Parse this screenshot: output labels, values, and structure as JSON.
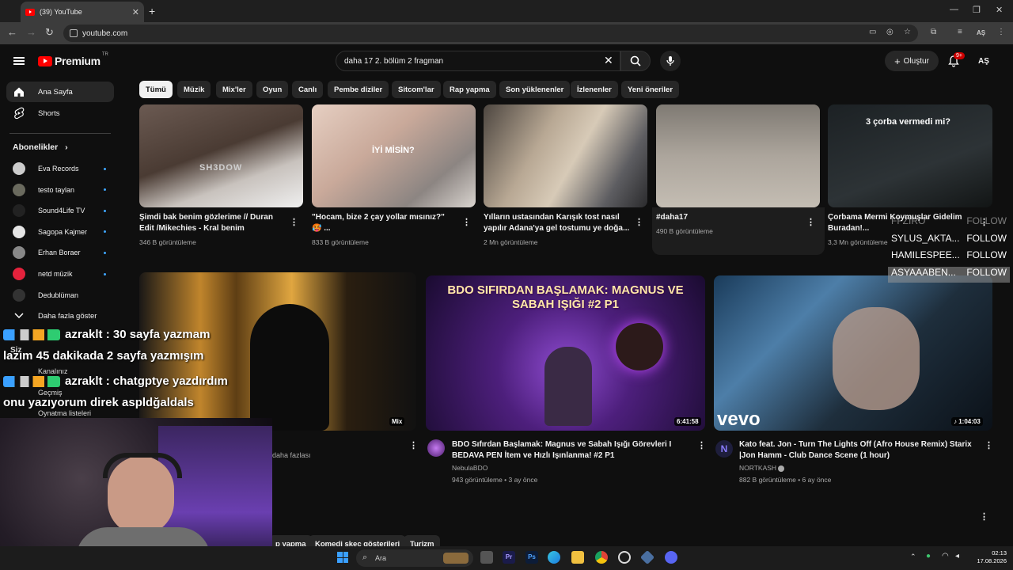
{
  "browser": {
    "tab_title": "(39) YouTube",
    "tab_close": "✕",
    "new_tab": "+",
    "url": "youtube.com",
    "profile_initials": "AŞ"
  },
  "header": {
    "logo_text": "Premium",
    "logo_region": "TR",
    "search_value": "daha 17 2. bölüm 2 fragman",
    "clear": "✕",
    "create_label": "Oluştur",
    "notif_count": "9+",
    "avatar_initials": "AŞ"
  },
  "chips": [
    "Tümü",
    "Müzik",
    "Mix'ler",
    "Oyun",
    "Canlı",
    "Pembe diziler",
    "Sitcom'lar",
    "Rap yapma",
    "Son yüklenenler",
    "İzlenenler",
    "Yeni öneriler"
  ],
  "sidebar": {
    "home": "Ana Sayfa",
    "shorts": "Shorts",
    "subscriptions_title": "Abonelikler",
    "subs": [
      "Eva Records",
      "testo taylan",
      "Sound4Life TV",
      "Sagopa Kajmer",
      "Erhan Boraer",
      "netd müzik",
      "Dedublüman"
    ],
    "show_more": "Daha fazla göster",
    "you": "Siz",
    "your_channel": "Kanalınız",
    "history": "Geçmiş",
    "playlists": "Oynatma listeleri"
  },
  "row1": [
    {
      "title1": "Şimdi bak benim gözlerime // Duran",
      "title2": "Edit /Mikechies - Kral benim",
      "meta": "346 B görüntüleme",
      "overlay": "SH3DOW"
    },
    {
      "title1": "\"Hocam, bize 2 çay yollar mısınız?\"",
      "title2": "🥵 ...",
      "meta": "833 B görüntüleme",
      "overlay": "İYİ MİSİN?"
    },
    {
      "title1": "Yılların ustasından Karışık tost nasıl",
      "title2": "yapılır Adana'ya gel tostumu ye doğa...",
      "meta": "2 Mn görüntüleme"
    },
    {
      "title1": "#daha17",
      "title2": "",
      "meta": "490 B görüntüleme"
    },
    {
      "title1": "Çorbama Mermi Koymuşlar Gidelim",
      "title2": "Buradan!...",
      "meta": "3,3 Mn görüntüleme",
      "overlay": "3 çorba vermedi mi?"
    }
  ],
  "row2": [
    {
      "badge": "Mix",
      "meta": "daha fazlası"
    },
    {
      "title1": "BDO Sıfırdan Başlamak: Magnus ve Sabah Işığı Görevleri I",
      "title2": "BEDAVA PEN İtem ve Hızlı Işınlanma! #2 P1",
      "channel": "NebulaBDO",
      "meta": "943 görüntüleme • 3 ay önce",
      "duration": "6:41:58",
      "thumb_text": "BDO SIFIRDAN BAŞLAMAK: MAGNUS VE SABAH IŞIĞI #2 P1"
    },
    {
      "title1": "Kato feat. Jon - Turn The Lights Off (Afro House Remix) Starix",
      "title2": "|Jon Hamm - Club Dance Scene (1 hour)",
      "channel": "NORTKASH",
      "meta": "882 B görüntüleme • 6 ay önce",
      "duration": "1:04:03",
      "thumb_text": "vevo"
    }
  ],
  "bottom_chips": [
    "p yapma",
    "Komedi skeç gösterileri",
    "Turizm"
  ],
  "overlay": {
    "follows": [
      {
        "name": "FFZIRO",
        "action": "FOLLOW"
      },
      {
        "name": "SYLUS_AKTA...",
        "action": "FOLLOW"
      },
      {
        "name": "HAMILESPEE...",
        "action": "FOLLOW"
      },
      {
        "name": "ASYAAABEN...",
        "action": "FOLLOW"
      }
    ],
    "chat": [
      "azraklt : 30 sayfa yazmam",
      "lazım 45 dakikada 2 sayfa yazmışım",
      "azraklt : chatgptye yazdırdım",
      "onu yazıyorum direk aspldğaldals"
    ]
  },
  "taskbar": {
    "search_placeholder": "Ara",
    "time": "02:13",
    "date": "17.08.2026"
  }
}
